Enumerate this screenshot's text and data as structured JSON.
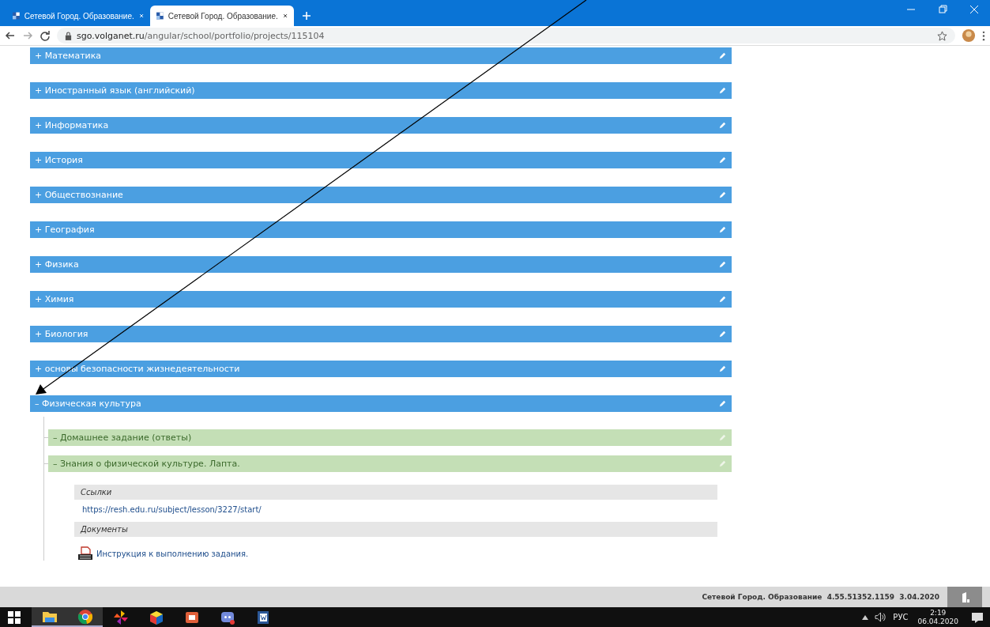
{
  "browser": {
    "tabs": [
      {
        "title": "Сетевой Город. Образование.",
        "selected": false
      },
      {
        "title": "Сетевой Город. Образование.",
        "selected": true
      }
    ],
    "url_host": "sgo.volganet.ru",
    "url_path": "/angular/school/portfolio/projects/115104"
  },
  "subjects": [
    {
      "toggle": "+",
      "label": "Математика"
    },
    {
      "toggle": "+",
      "label": "Иностранный язык (английский)"
    },
    {
      "toggle": "+",
      "label": "Информатика"
    },
    {
      "toggle": "+",
      "label": "История"
    },
    {
      "toggle": "+",
      "label": "Обществознание"
    },
    {
      "toggle": "+",
      "label": "География"
    },
    {
      "toggle": "+",
      "label": "Физика"
    },
    {
      "toggle": "+",
      "label": "Химия"
    },
    {
      "toggle": "+",
      "label": "Биология"
    },
    {
      "toggle": "+",
      "label": "основы безопасности жизнедеятельности"
    },
    {
      "toggle": "–",
      "label": "Физическая культура",
      "children": [
        {
          "toggle": "–",
          "label": "Домашнее задание (ответы)"
        },
        {
          "toggle": "–",
          "label": "Знания о физической культуре. Лапта.",
          "details": {
            "links_title": "Ссылки",
            "link": "https://resh.edu.ru/subject/lesson/3227/start/",
            "docs_title": "Документы",
            "doc": "Инструкция к выполнению задания."
          }
        }
      ]
    }
  ],
  "footer": "Сетевой Город. Образование  4.55.51352.1159  3.04.2020",
  "tray": {
    "lang": "РУС",
    "time": "2:19",
    "date": "06.04.2020"
  }
}
